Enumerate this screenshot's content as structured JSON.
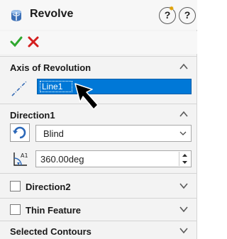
{
  "header": {
    "title": "Revolve",
    "help_glyph": "?",
    "help2_glyph": "?",
    "title_icon": "revolve-feature-icon"
  },
  "actions": {
    "ok_icon": "checkmark-icon",
    "cancel_icon": "close-icon",
    "ok_color": "#2ea82e",
    "cancel_color": "#d41e1e"
  },
  "axis": {
    "title": "Axis of Revolution",
    "value": "Line1",
    "selection_color": "#0078d7"
  },
  "direction1": {
    "title": "Direction1",
    "end_condition": "Blind",
    "angle": "360.00deg"
  },
  "direction2": {
    "title": "Direction2",
    "checked": false
  },
  "thin_feature": {
    "title": "Thin Feature",
    "checked": false
  },
  "selected_contours": {
    "title": "Selected Contours"
  }
}
